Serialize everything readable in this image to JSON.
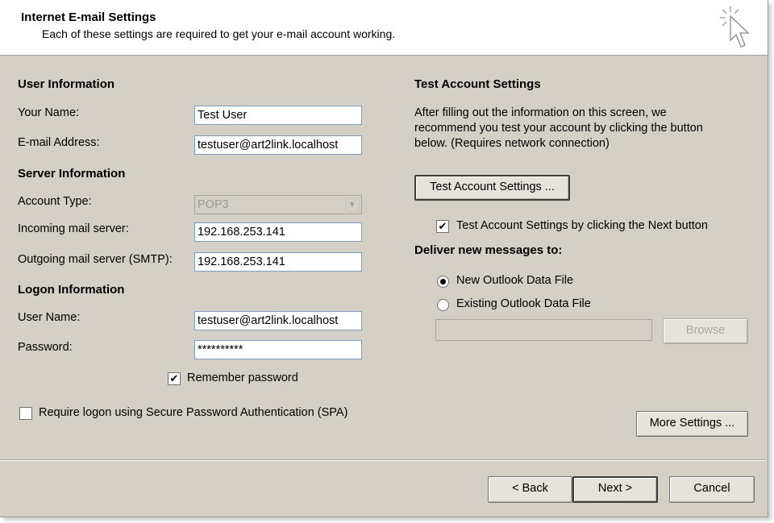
{
  "header": {
    "title": "Internet E-mail Settings",
    "subtitle": "Each of these settings are required to get your e-mail account working."
  },
  "user_info": {
    "heading": "User Information",
    "name_label": "Your Name:",
    "name_value": "Test User",
    "email_label": "E-mail Address:",
    "email_value": "testuser@art2link.localhost"
  },
  "server_info": {
    "heading": "Server Information",
    "account_type_label": "Account Type:",
    "account_type_value": "POP3",
    "incoming_label": "Incoming mail server:",
    "incoming_value": "192.168.253.141",
    "outgoing_label": "Outgoing mail server (SMTP):",
    "outgoing_value": "192.168.253.141"
  },
  "logon_info": {
    "heading": "Logon Information",
    "username_label": "User Name:",
    "username_value": "testuser@art2link.localhost",
    "password_label": "Password:",
    "password_value": "**********",
    "remember_label": "Remember password",
    "remember_checked": true,
    "spa_label": "Require logon using Secure Password Authentication (SPA)",
    "spa_checked": false
  },
  "test_settings": {
    "heading": "Test Account Settings",
    "description_line1": "After filling out the information on this screen, we",
    "description_line2": "recommend you test your account by clicking the button",
    "description_line3": "below. (Requires network connection)",
    "test_button": "Test Account Settings ...",
    "test_on_next_label": "Test Account Settings by clicking the Next button",
    "test_on_next_checked": true
  },
  "deliver": {
    "heading": "Deliver new messages to:",
    "option_new": "New Outlook Data File",
    "option_existing": "Existing Outlook Data File",
    "selected": "new",
    "existing_path": "",
    "browse_button": "Browse"
  },
  "more_settings_button": "More Settings ...",
  "footer": {
    "back_button": "< Back",
    "next_button": "Next >",
    "cancel_button": "Cancel"
  }
}
